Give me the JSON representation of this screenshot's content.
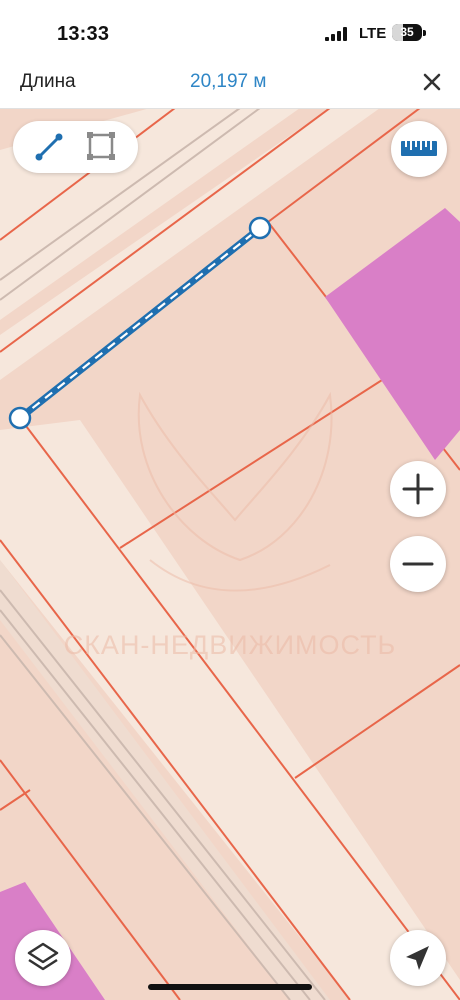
{
  "status_bar": {
    "time": "13:33",
    "network": "LTE",
    "battery": "35",
    "battery_level_percent": 35
  },
  "top_bar": {
    "title": "Длина",
    "value": "20,197 м",
    "close_icon": "close-icon"
  },
  "map": {
    "watermark": "СКАН-НЕДВИЖИМОСТЬ",
    "colors": {
      "background": "#f2d6c8",
      "road": "#f6e7dc",
      "boundary": "#e8664a",
      "building": "#d97fc7",
      "measure_line": "#1f6fb0"
    }
  },
  "toolbar": {
    "tools": [
      {
        "name": "measure-line",
        "icon": "line-icon",
        "active": true
      },
      {
        "name": "measure-area",
        "icon": "polygon-icon",
        "active": false
      }
    ],
    "ruler_icon": "ruler-icon"
  },
  "controls": {
    "zoom_in_icon": "plus-icon",
    "zoom_out_icon": "minus-icon",
    "layers_icon": "layers-icon",
    "locate_icon": "navigation-arrow-icon"
  }
}
